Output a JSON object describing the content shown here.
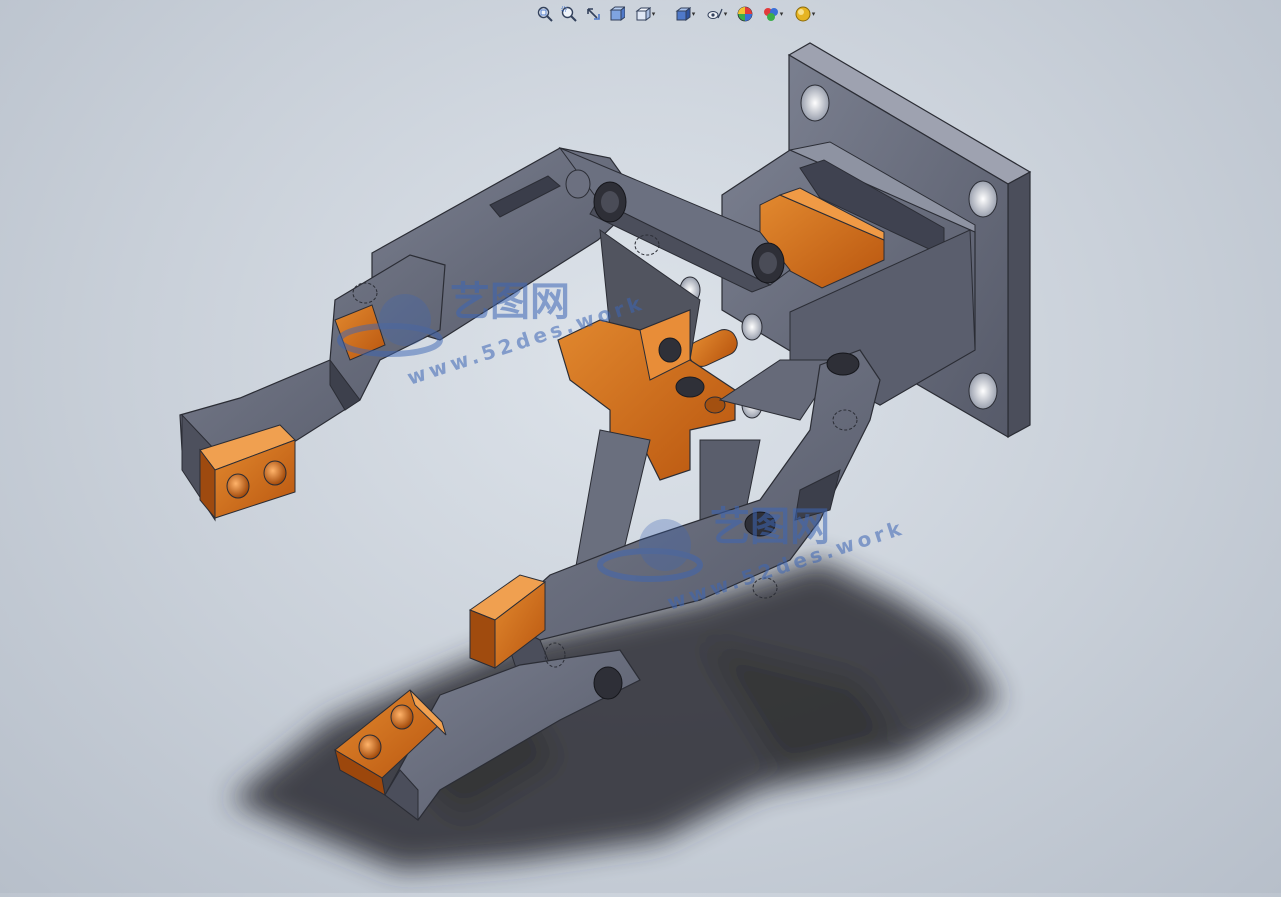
{
  "app": {
    "window_title": "",
    "view": "3D model viewport"
  },
  "toolbar": {
    "items": [
      {
        "name": "zoom-to-fit-icon",
        "dropdown": false
      },
      {
        "name": "zoom-to-area-icon",
        "dropdown": false
      },
      {
        "name": "previous-view-icon",
        "dropdown": false
      },
      {
        "name": "section-view-icon",
        "dropdown": false
      },
      {
        "name": "view-orientation-icon",
        "dropdown": true
      },
      {
        "name": "display-style-icon",
        "dropdown": true
      },
      {
        "name": "hide-show-items-icon",
        "dropdown": true
      },
      {
        "name": "edit-appearance-icon",
        "dropdown": false
      },
      {
        "name": "apply-scene-icon",
        "dropdown": true
      },
      {
        "name": "view-settings-icon",
        "dropdown": true
      }
    ],
    "caret_glyph": "▾"
  },
  "watermark": {
    "cn_text": "艺图网",
    "url_text_1": "www.52des.work",
    "url_text_2": "www.52des.work"
  },
  "colors": {
    "metal_gray": "#5c6070",
    "metal_gray_light": "#757a8a",
    "metal_gray_dark": "#454857",
    "copper": "#c8641a",
    "copper_light": "#e08530",
    "copper_dark": "#8a3f0c",
    "shadow": "#1f2024",
    "watermark_blue": "#3d66b5"
  }
}
